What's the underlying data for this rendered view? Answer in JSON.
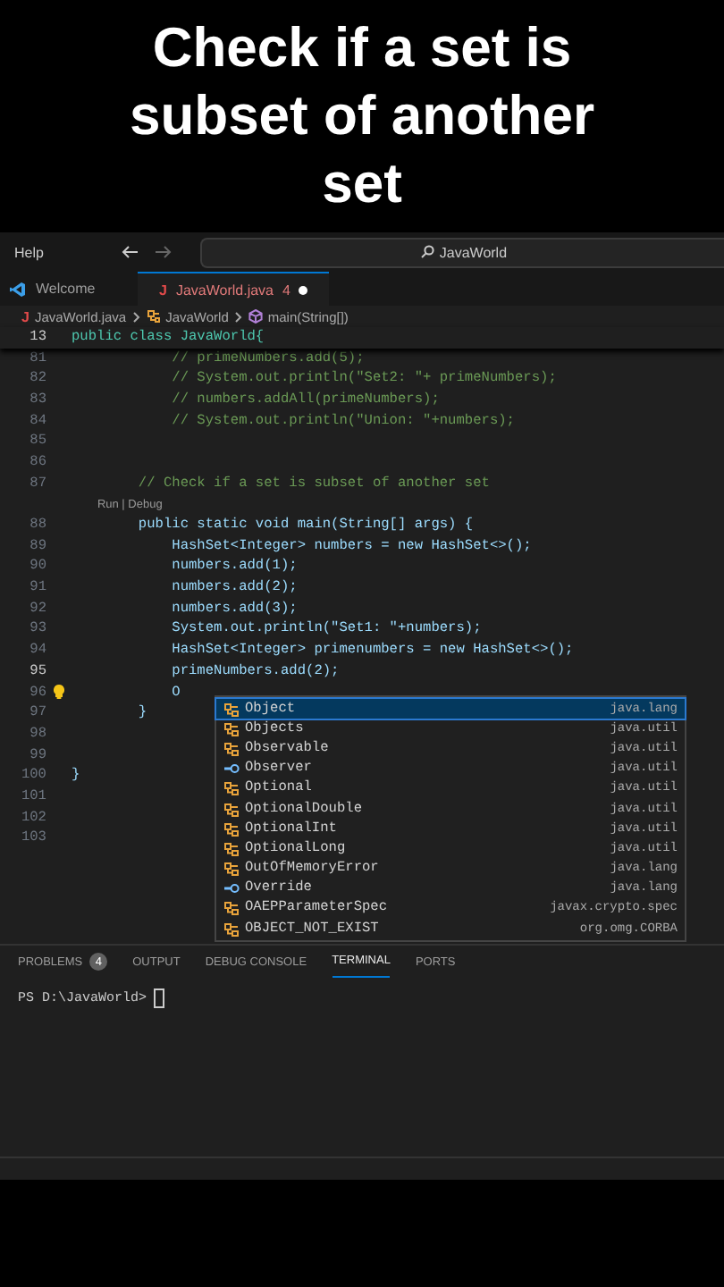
{
  "video_title": "Check if a set is subset of another set",
  "titlebar": {
    "menu": "Help",
    "search": "JavaWorld"
  },
  "tabs": [
    {
      "label": "Welcome",
      "kind": "welcome",
      "selected": false
    },
    {
      "label": "JavaWorld.java",
      "kind": "java",
      "icon_text": "J",
      "selected": true,
      "problems": "4",
      "modified": true
    }
  ],
  "breadcrumb": [
    {
      "label": "JavaWorld.java",
      "kind": "java",
      "icon_text": "J"
    },
    {
      "label": "JavaWorld",
      "kind": "class"
    },
    {
      "label": "main(String[])",
      "kind": "method"
    }
  ],
  "sticky_line": {
    "number": "13",
    "text": "public class JavaWorld{"
  },
  "lines": [
    {
      "number": "81",
      "kind": "comment",
      "text": "            // primeNumbers.add(5);"
    },
    {
      "number": "82",
      "kind": "comment",
      "text": "            // System.out.println(\"Set2: \"+ primeNumbers);"
    },
    {
      "number": "83",
      "kind": "comment",
      "text": "            // numbers.addAll(primeNumbers);"
    },
    {
      "number": "84",
      "kind": "comment",
      "text": "            // System.out.println(\"Union: \"+numbers);"
    },
    {
      "number": "85",
      "kind": "code"
    },
    {
      "number": "86",
      "kind": "code"
    },
    {
      "number": "87",
      "kind": "comment",
      "text": "        // Check if a set is subset of another set"
    },
    {
      "kind": "codelens",
      "text": "        Run | Debug"
    },
    {
      "number": "88",
      "kind": "code",
      "text": "        public static void main(String[] args) {"
    },
    {
      "number": "89",
      "kind": "code",
      "text": "            HashSet<Integer> numbers = new HashSet<>();"
    },
    {
      "number": "90",
      "kind": "code",
      "text": "            numbers.add(1);"
    },
    {
      "number": "91",
      "kind": "code",
      "text": "            numbers.add(2);"
    },
    {
      "number": "92",
      "kind": "code",
      "text": "            numbers.add(3);"
    },
    {
      "number": "93",
      "kind": "code",
      "text": "            System.out.println(\"Set1: \"+numbers);"
    },
    {
      "number": "94",
      "kind": "code",
      "text": "            HashSet<Integer> primenumbers = new HashSet<>();"
    },
    {
      "number": "95",
      "kind": "code",
      "text": "            primeNumbers.add(2);"
    },
    {
      "number": "96",
      "kind": "code",
      "text": "            O",
      "lightbulb": true
    },
    {
      "number": "97",
      "kind": "code",
      "text": "        }"
    },
    {
      "number": "98",
      "kind": "code"
    },
    {
      "number": "99",
      "kind": "code"
    },
    {
      "number": "100",
      "kind": "code",
      "text": "}"
    },
    {
      "number": "101",
      "kind": "code"
    },
    {
      "number": "102",
      "kind": "code"
    },
    {
      "number": "103",
      "kind": "code"
    }
  ],
  "suggestions": [
    {
      "label": "Object",
      "package": "java.lang",
      "kind": "class",
      "selected": true
    },
    {
      "label": "Objects",
      "package": "java.util",
      "kind": "class",
      "selected": false
    },
    {
      "label": "Observable",
      "package": "java.util",
      "kind": "class",
      "selected": false
    },
    {
      "label": "Observer",
      "package": "java.util",
      "kind": "interface",
      "selected": false
    },
    {
      "label": "Optional",
      "package": "java.util",
      "kind": "class",
      "selected": false
    },
    {
      "label": "OptionalDouble",
      "package": "java.util",
      "kind": "class",
      "selected": false
    },
    {
      "label": "OptionalInt",
      "package": "java.util",
      "kind": "class",
      "selected": false
    },
    {
      "label": "OptionalLong",
      "package": "java.util",
      "kind": "class",
      "selected": false
    },
    {
      "label": "OutOfMemoryError",
      "package": "java.lang",
      "kind": "class",
      "selected": false
    },
    {
      "label": "Override",
      "package": "java.lang",
      "kind": "interface",
      "selected": false
    },
    {
      "label": "OAEPParameterSpec",
      "package": "javax.crypto.spec",
      "kind": "class",
      "selected": false
    },
    {
      "label": "OBJECT_NOT_EXIST",
      "package": "org.omg.CORBA",
      "kind": "class",
      "selected": false
    }
  ],
  "panel_tabs": [
    {
      "label": "PROBLEMS",
      "badge": "4",
      "selected": false
    },
    {
      "label": "OUTPUT",
      "selected": false
    },
    {
      "label": "DEBUG CONSOLE",
      "selected": false
    },
    {
      "label": "TERMINAL",
      "selected": true
    },
    {
      "label": "PORTS",
      "selected": false
    }
  ],
  "terminal": {
    "prompt": "PS D:\\JavaWorld>"
  }
}
